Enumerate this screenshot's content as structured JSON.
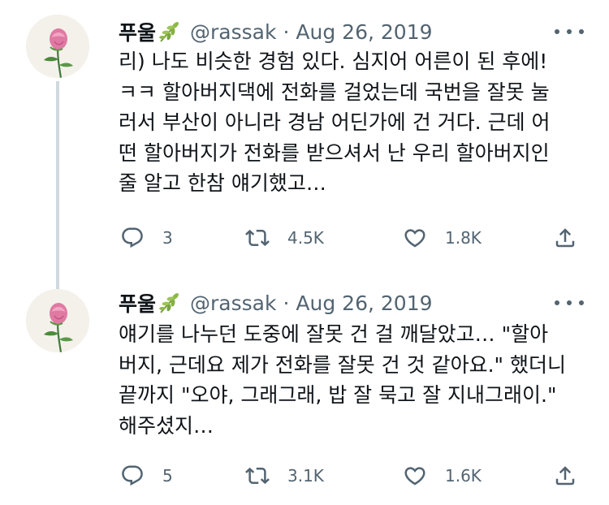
{
  "tweets": [
    {
      "display_name": "푸울",
      "name_emoji_icon": "herb-leaf-icon",
      "handle": "@rassak",
      "separator": "·",
      "date": "Aug 26, 2019",
      "text_lines": [
        "리) 나도 비슷한 경험 있다. 심지어 어른이 된 후에!",
        "ㅋㅋ 할아버지댁에 전화를 걸었는데 국번을 잘못 눌",
        "러서 부산이 아니라 경남 어딘가에 건 거다. 근데 어",
        "떤 할아버지가 전화를 받으셔서 난 우리 할아버지인",
        "줄 알고 한참 얘기했고…"
      ],
      "replies": "3",
      "retweets": "4.5K",
      "likes": "1.8K"
    },
    {
      "display_name": "푸울",
      "name_emoji_icon": "herb-leaf-icon",
      "handle": "@rassak",
      "separator": "·",
      "date": "Aug 26, 2019",
      "text_lines": [
        "얘기를 나누던 도중에 잘못 건 걸 깨달았고… \"할아",
        "버지, 근데요 제가 전화를 잘못 건 것 같아요.\" 했더니",
        "끝까지 \"오야, 그래그래, 밥 잘 묵고 잘 지내그래이.\"",
        "해주셨지…"
      ],
      "replies": "5",
      "retweets": "3.1K",
      "likes": "1.6K"
    }
  ],
  "icons": {
    "avatar": "pink-rose-avatar",
    "reply": "reply-icon",
    "retweet": "retweet-icon",
    "like": "heart-icon",
    "share": "share-icon",
    "more": "more-options-icon"
  },
  "colors": {
    "text": "#0f1419",
    "secondary": "#536471",
    "thread_line": "#cfd9de"
  }
}
